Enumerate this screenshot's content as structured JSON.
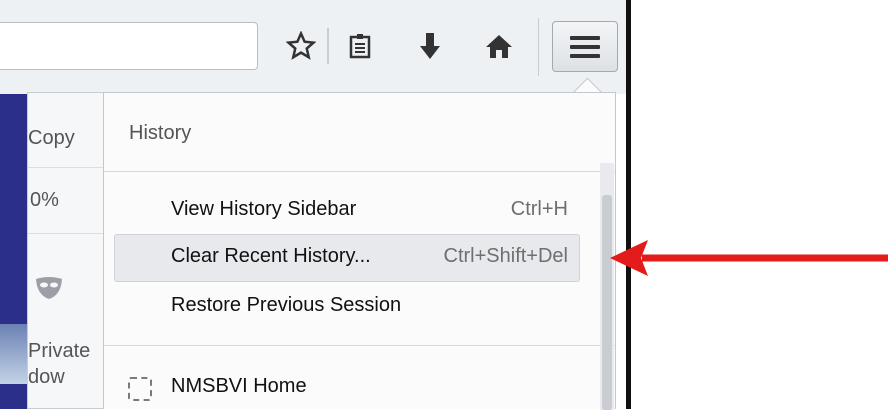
{
  "toolbar": {
    "url_value": "",
    "bookmark_icon": "star-icon",
    "reading_list_icon": "reading-list-icon",
    "downloads_icon": "download-arrow-icon",
    "home_icon": "home-icon",
    "menu_icon": "hamburger-menu-icon"
  },
  "main_panel": {
    "copy_label": "Copy",
    "zoom_label": "0%",
    "private_line1": "Private",
    "private_line2": "dow",
    "private_icon": "mask-icon"
  },
  "history_panel": {
    "title": "History",
    "items": [
      {
        "label": "View History Sidebar",
        "shortcut": "Ctrl+H"
      },
      {
        "label": "Clear Recent History...",
        "shortcut": "Ctrl+Shift+Del"
      },
      {
        "label": "Restore Previous Session",
        "shortcut": ""
      }
    ],
    "history_entry": {
      "label": "NMSBVI Home",
      "icon": "dashed-favicon-icon"
    }
  },
  "annotation": {
    "color": "#e41b1b",
    "icon": "red-arrow-icon"
  }
}
